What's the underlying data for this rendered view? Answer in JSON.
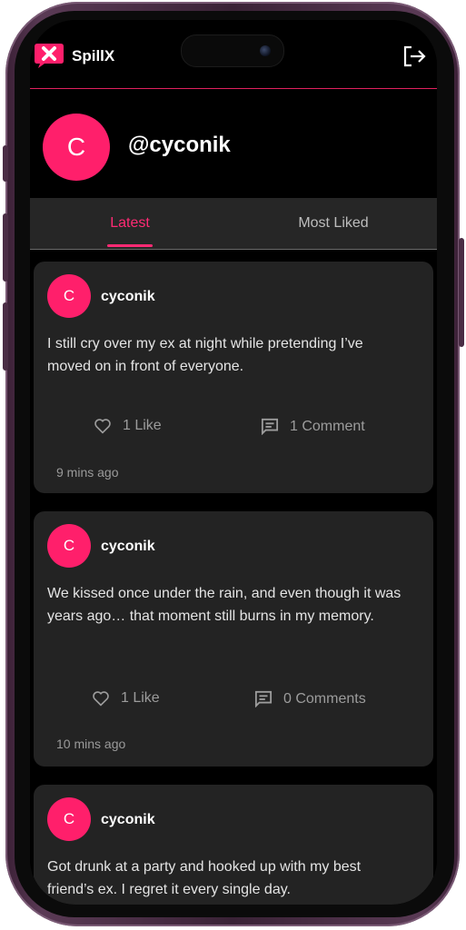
{
  "app": {
    "title": "SpillX",
    "accent": "#ff1f6b"
  },
  "profile": {
    "avatar_letter": "C",
    "username": "@cyconik"
  },
  "tabs": [
    {
      "label": "Latest"
    },
    {
      "label": "Most Liked"
    }
  ],
  "posts": [
    {
      "avatar_letter": "C",
      "user": "cyconik",
      "text": "I still cry over my ex at night while pretending I’ve moved on in front of everyone.",
      "likes": "1 Like",
      "comments": "1 Comment",
      "time": "9 mins ago"
    },
    {
      "avatar_letter": "C",
      "user": "cyconik",
      "text": "We kissed once under the rain, and even though it was years ago… that moment still burns in my memory.",
      "likes": "1 Like",
      "comments": "0 Comments",
      "time": "10 mins ago"
    },
    {
      "avatar_letter": "C",
      "user": "cyconik",
      "text": "Got drunk at a party and hooked up with my best friend’s ex. I regret it every single day."
    }
  ]
}
